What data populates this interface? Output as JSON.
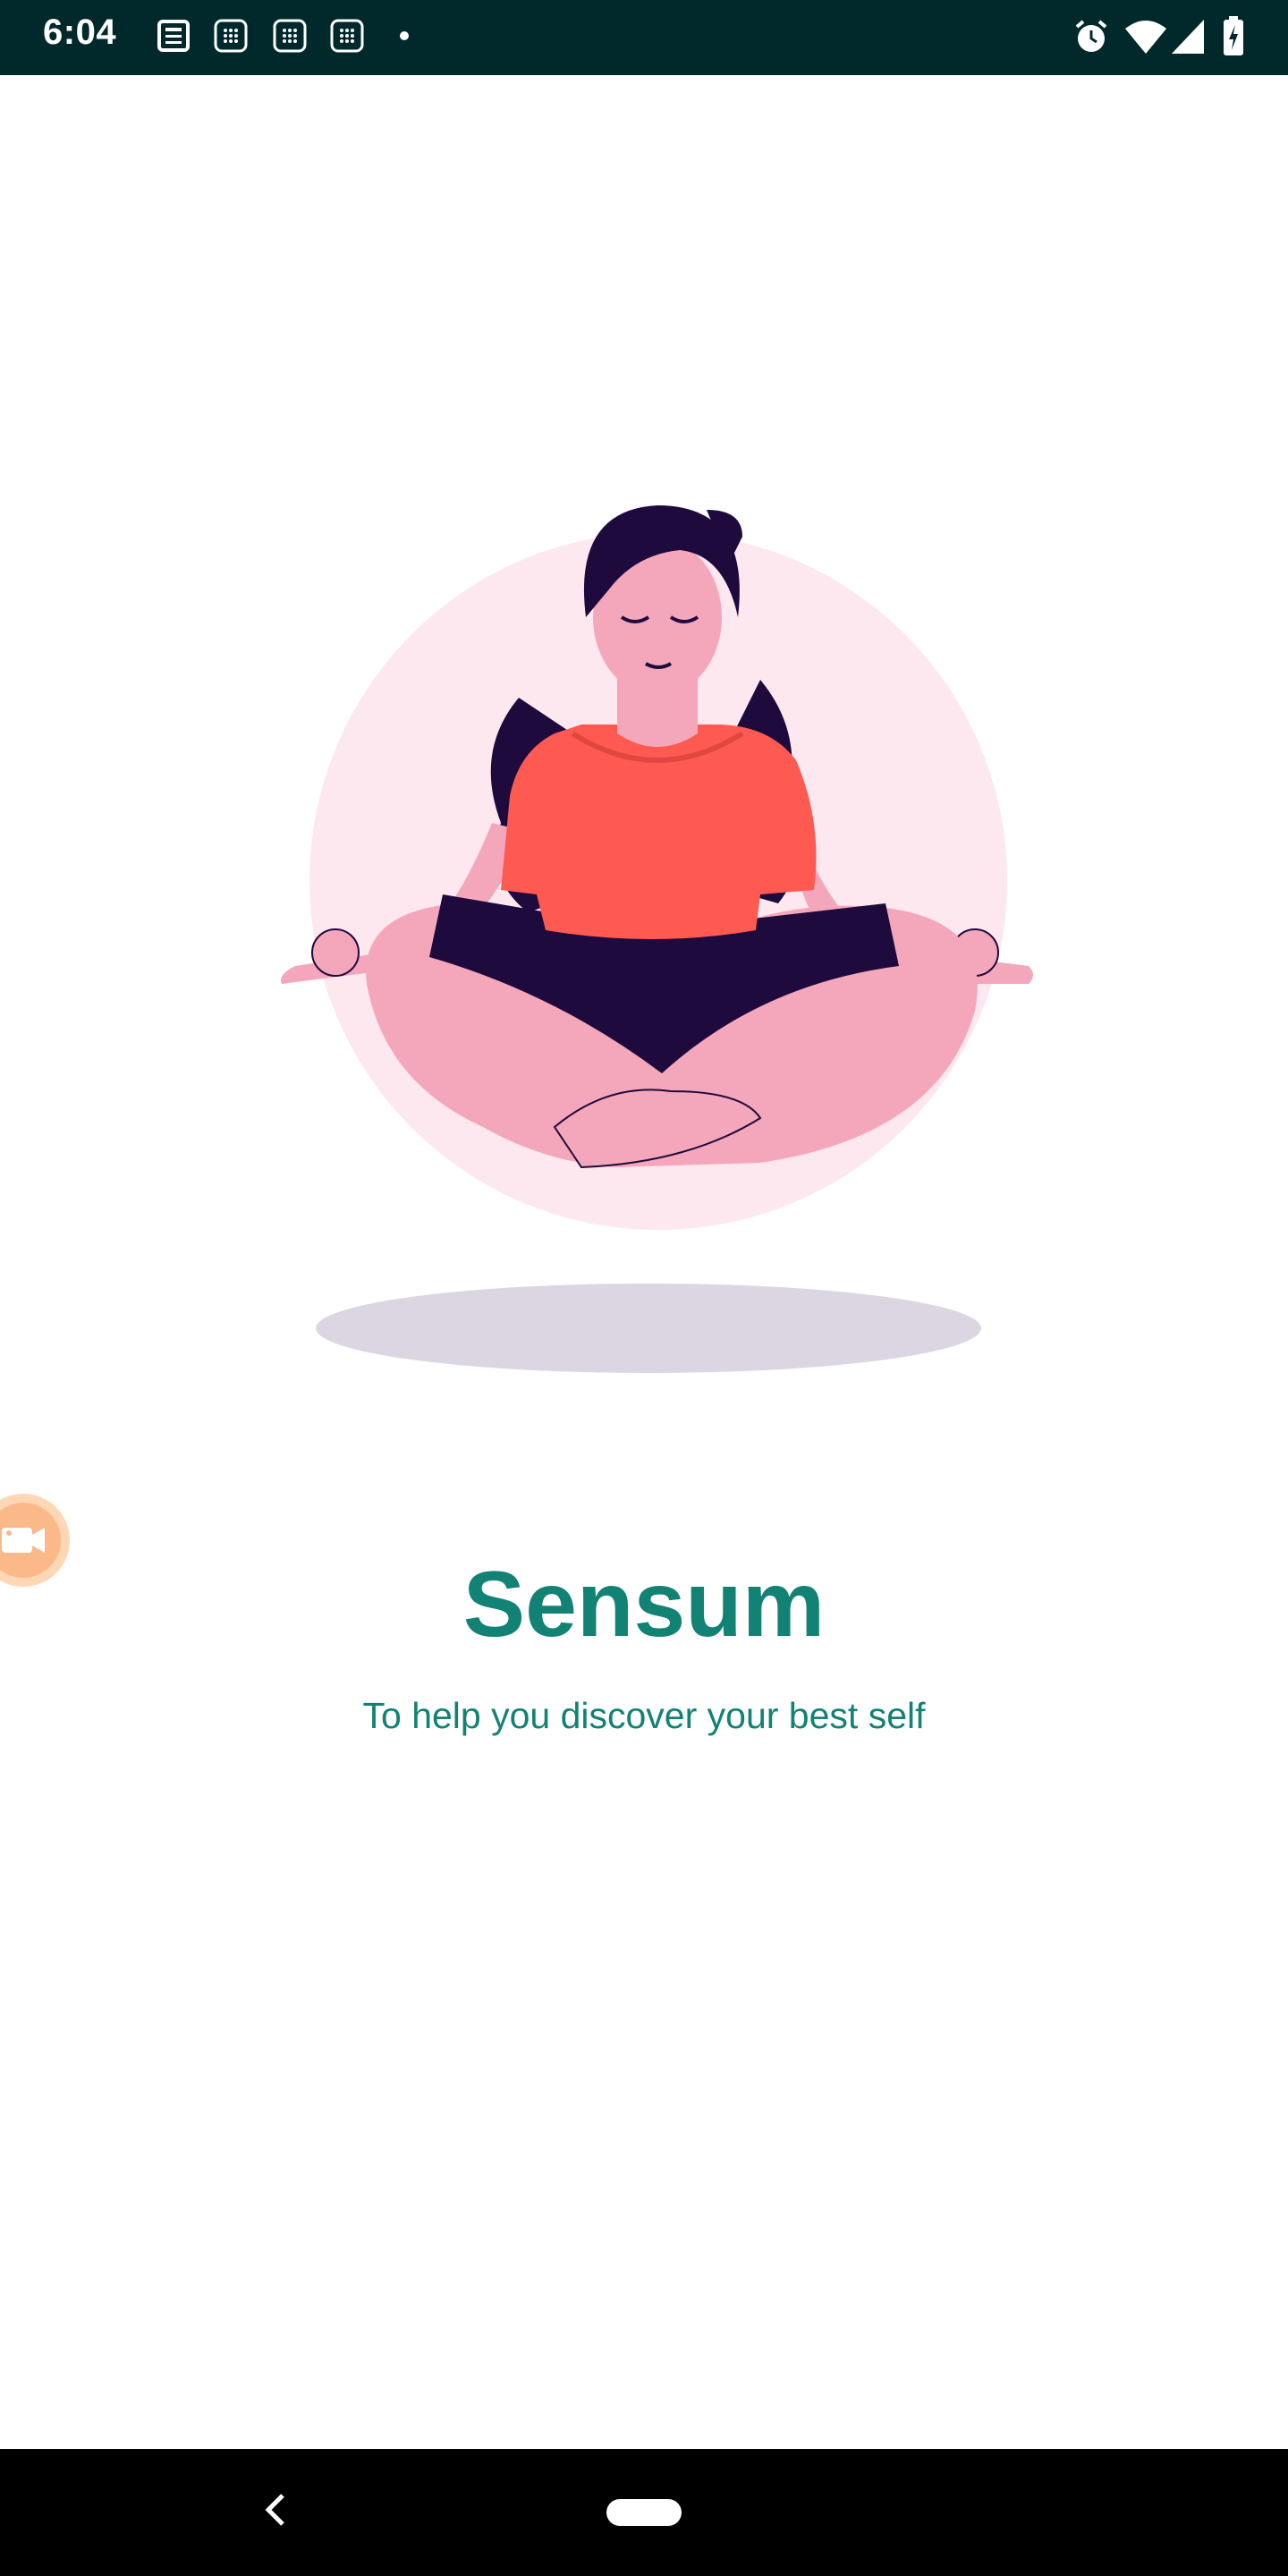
{
  "status_bar": {
    "time": "6:04",
    "notification_icons": [
      "news-icon",
      "calendar-icon",
      "calendar-icon",
      "calendar-icon",
      "dot-icon"
    ],
    "system_icons": [
      "alarm-icon",
      "wifi-icon",
      "cell-signal-icon",
      "battery-icon"
    ]
  },
  "app": {
    "title": "Sensum",
    "tagline": "To help you discover your best self"
  },
  "colors": {
    "accent": "#128274",
    "status_bar_bg": "#01292c",
    "shirt": "#ff5a52",
    "skin": "#f4a6bb",
    "hair": "#1e0a3c",
    "halo": "#fde8ef",
    "shadow": "#dcd6e2"
  },
  "overlay": {
    "floating_button_icon": "video-camera-icon"
  },
  "nav_bar": {
    "icons": [
      "back-icon",
      "home-pill-icon"
    ]
  }
}
